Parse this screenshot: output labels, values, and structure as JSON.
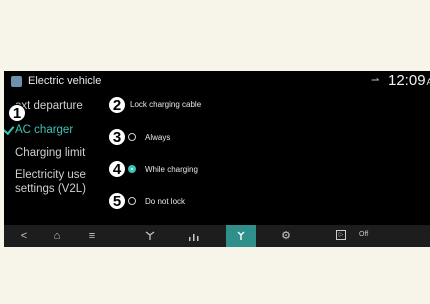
{
  "header": {
    "app_title": "Electric vehicle",
    "time": "12:09",
    "ampm": "AM"
  },
  "menu": {
    "items": [
      {
        "label": "ext departure"
      },
      {
        "label": "AC charger",
        "active": true
      },
      {
        "label": "Charging limit"
      },
      {
        "label": "Electricity use settings (V2L)"
      }
    ]
  },
  "lock_cable": {
    "heading": "Lock charging cable",
    "options": [
      {
        "label": "Always",
        "selected": false
      },
      {
        "label": "While charging",
        "selected": true
      },
      {
        "label": "Do not lock",
        "selected": false
      }
    ]
  },
  "callouts": [
    "1",
    "2",
    "3",
    "4",
    "5"
  ],
  "navbar": {
    "back": "<",
    "home": "⌂",
    "menu": "≡",
    "off_label": "Off"
  },
  "colors": {
    "accent": "#3ec4b6",
    "screen_bg": "#000000",
    "page_bg": "#f7f4ea"
  }
}
